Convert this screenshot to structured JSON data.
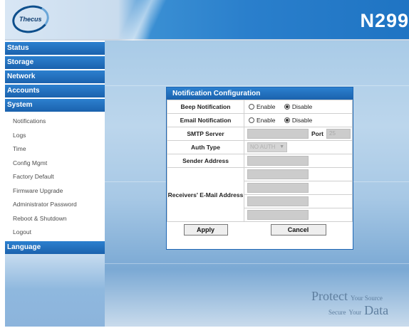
{
  "header": {
    "logo_text": "Thecus",
    "model": "N299"
  },
  "sidebar": {
    "sections_top": [
      "Status",
      "Storage",
      "Network",
      "Accounts",
      "System"
    ],
    "system_items": [
      "Notifications",
      "Logs",
      "Time",
      "Config Mgmt",
      "Factory Default",
      "Firmware Upgrade",
      "Administrator Password",
      "Reboot & Shutdown",
      "Logout"
    ],
    "sections_bottom": [
      "Language"
    ]
  },
  "dialog": {
    "title": "Notification Configuration",
    "beep_label": "Beep Notification",
    "beep_enable": "Enable",
    "beep_disable": "Disable",
    "email_label": "Email Notification",
    "email_enable": "Enable",
    "email_disable": "Disable",
    "smtp_label": "SMTP Server",
    "smtp_value": "",
    "port_label": "Port",
    "port_value": "25",
    "auth_label": "Auth Type",
    "auth_value": "NO AUTH",
    "sender_label": "Sender Address",
    "sender_value": "",
    "receivers_label": "Receivers' E-Mail Address",
    "receivers": [
      "",
      "",
      "",
      ""
    ],
    "apply": "Apply",
    "cancel": "Cancel",
    "beep_selected": "Disable",
    "email_selected": "Disable"
  },
  "slogan": {
    "protect": "Protect",
    "your_source": "Your Source",
    "secure": "Secure",
    "your": "Your",
    "data": "Data"
  },
  "colors": {
    "menu_blue": "#1b62ad",
    "header_blue": "#2a7fcc",
    "background_blue": "#a9cbe7",
    "slogan": "#5f7f9f"
  }
}
